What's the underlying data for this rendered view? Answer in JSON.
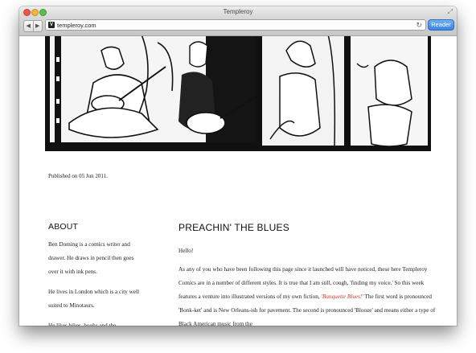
{
  "window": {
    "title": "Templeroy"
  },
  "toolbar": {
    "back_icon": "back-icon",
    "forward_icon": "forward-icon",
    "url": "templeroy.com",
    "reload_icon": "reload-icon",
    "reader_label": "Reader"
  },
  "page": {
    "published": "Published on 05 Jun 2011.",
    "sidebar": {
      "title": "ABOUT",
      "p1": "Ben Doming is a comics writer and drawer. He draws in pencil then goes over it with ink pens.",
      "p2": "He lives in London which is a city well suited to Minotaurs.",
      "p3": "He likes bikes, books and the"
    },
    "post": {
      "title": "PREACHIN' THE BLUES",
      "hello": "Hello!",
      "body_a": "As any of you who have been following this page since it launched will have noticed, these here Templeroy Comics are in a number of different styles. It is true that I am still, cough, 'finding my voice.' So this week features a venture into illustrated versions of my own fiction, ",
      "body_link": "'Banquette Blues!'",
      "body_b": " The first word is pronounced 'Bonk-ket' and is New Orleans-ish for pavement. The second is pronounced 'Blooze' and means either a type of Black American music from the"
    }
  },
  "colors": {
    "link_red": "#d33a2c",
    "reader_blue": "#3b84e0"
  }
}
